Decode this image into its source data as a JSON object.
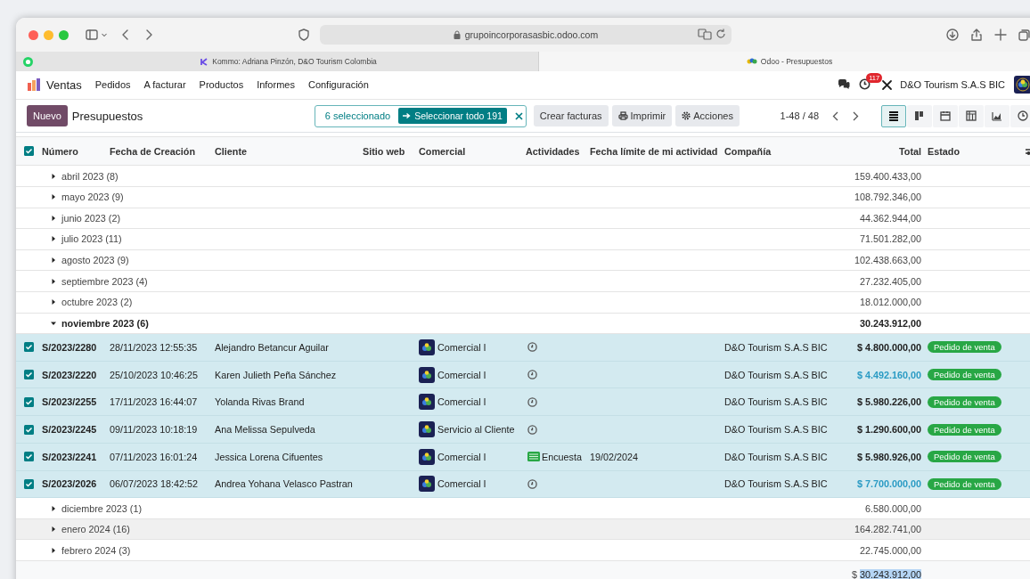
{
  "browser": {
    "url": "grupoincorporasasbic.odoo.com",
    "tabs": [
      {
        "title": "Kommo: Adriana Pinzón, D&O Tourism Colombia",
        "selected": false
      },
      {
        "title": "Odoo - Presupuestos",
        "selected": true
      }
    ]
  },
  "navbar": {
    "app": "Ventas",
    "menu": [
      "Pedidos",
      "A facturar",
      "Productos",
      "Informes",
      "Configuración"
    ],
    "activity_count": "117",
    "company": "D&O Tourism S.A.S BIC"
  },
  "control_panel": {
    "new_button": "Nuevo",
    "breadcrumb": "Presupuestos",
    "selected_count": "6 seleccionado",
    "select_all": "Seleccionar todo 191",
    "actions": [
      {
        "kind": "plain",
        "label": "Crear facturas"
      },
      {
        "kind": "print",
        "label": "Imprimir"
      },
      {
        "kind": "gear",
        "label": "Acciones"
      }
    ],
    "pager": "1-48 / 48",
    "views": [
      {
        "kind": "list",
        "selected": true
      },
      {
        "kind": "kanban",
        "selected": false
      },
      {
        "kind": "calendar",
        "selected": false
      },
      {
        "kind": "pivot",
        "selected": false
      },
      {
        "kind": "graph",
        "selected": false
      },
      {
        "kind": "activity",
        "selected": false
      }
    ]
  },
  "table": {
    "all_checked": true,
    "columns": [
      "Número",
      "Fecha de Creación",
      "Cliente",
      "Sitio web",
      "Comercial",
      "Actividades",
      "Fecha límite de mi actividad",
      "Compañía",
      "Total",
      "Estado"
    ],
    "rows": [
      {
        "kind": "group",
        "label": "abril 2023 (8)",
        "expanded": false,
        "hovered": false,
        "total": "159.400.433,00"
      },
      {
        "kind": "group",
        "label": "mayo 2023 (9)",
        "expanded": false,
        "hovered": false,
        "total": "108.792.346,00"
      },
      {
        "kind": "group",
        "label": "junio 2023 (2)",
        "expanded": false,
        "hovered": false,
        "total": "44.362.944,00"
      },
      {
        "kind": "group",
        "label": "julio 2023 (11)",
        "expanded": false,
        "hovered": false,
        "total": "71.501.282,00"
      },
      {
        "kind": "group",
        "label": "agosto 2023 (9)",
        "expanded": false,
        "hovered": false,
        "total": "102.438.663,00"
      },
      {
        "kind": "group",
        "label": "septiembre 2023 (4)",
        "expanded": false,
        "hovered": false,
        "total": "27.232.405,00"
      },
      {
        "kind": "group",
        "label": "octubre 2023 (2)",
        "expanded": false,
        "hovered": false,
        "total": "18.012.000,00"
      },
      {
        "kind": "group",
        "label": "noviembre 2023 (6)",
        "expanded": true,
        "hovered": false,
        "total": "30.243.912,00"
      },
      {
        "kind": "record",
        "checked": true,
        "number": "S/2023/2280",
        "date": "28/11/2023 12:55:35",
        "customer": "Alejandro Betancur Aguilar",
        "salesperson": "Comercial I",
        "activity": {
          "kind": "clock"
        },
        "company": "D&O Tourism S.A.S BIC",
        "total": "$ 4.800.000,00",
        "total_highlighted": false,
        "status": "Pedido de venta"
      },
      {
        "kind": "record",
        "checked": true,
        "number": "S/2023/2220",
        "date": "25/10/2023 10:46:25",
        "customer": "Karen Julieth Peña Sánchez",
        "salesperson": "Comercial I",
        "activity": {
          "kind": "clock"
        },
        "company": "D&O Tourism S.A.S BIC",
        "total": "$ 4.492.160,00",
        "total_highlighted": true,
        "status": "Pedido de venta"
      },
      {
        "kind": "record",
        "checked": true,
        "number": "S/2023/2255",
        "date": "17/11/2023 16:44:07",
        "customer": "Yolanda Rivas Brand",
        "salesperson": "Comercial I",
        "activity": {
          "kind": "clock"
        },
        "company": "D&O Tourism S.A.S BIC",
        "total": "$ 5.980.226,00",
        "total_highlighted": false,
        "status": "Pedido de venta"
      },
      {
        "kind": "record",
        "checked": true,
        "number": "S/2023/2245",
        "date": "09/11/2023 10:18:19",
        "customer": "Ana Melissa Sepulveda",
        "salesperson": "Servicio al Cliente",
        "activity": {
          "kind": "clock"
        },
        "company": "D&O Tourism S.A.S BIC",
        "total": "$ 1.290.600,00",
        "total_highlighted": false,
        "status": "Pedido de venta"
      },
      {
        "kind": "record",
        "checked": true,
        "number": "S/2023/2241",
        "date": "07/11/2023 16:01:24",
        "customer": "Jessica Lorena Cifuentes",
        "salesperson": "Comercial I",
        "activity": {
          "kind": "survey",
          "label": "Encuesta"
        },
        "deadline": "19/02/2024",
        "company": "D&O Tourism S.A.S BIC",
        "total": "$ 5.980.926,00",
        "total_highlighted": false,
        "status": "Pedido de venta"
      },
      {
        "kind": "record",
        "checked": true,
        "number": "S/2023/2026",
        "date": "06/07/2023 18:42:52",
        "customer": "Andrea Yohana Velasco Pastran",
        "salesperson": "Comercial I",
        "activity": {
          "kind": "clock"
        },
        "company": "D&O Tourism S.A.S BIC",
        "total": "$ 7.700.000,00",
        "total_highlighted": true,
        "status": "Pedido de venta"
      },
      {
        "kind": "group",
        "label": "diciembre 2023 (1)",
        "expanded": false,
        "hovered": false,
        "total": "6.580.000,00"
      },
      {
        "kind": "group",
        "label": "enero 2024 (16)",
        "expanded": false,
        "hovered": true,
        "total": "164.282.741,00"
      },
      {
        "kind": "group",
        "label": "febrero 2024 (3)",
        "expanded": false,
        "hovered": false,
        "total": "22.745.000,00"
      }
    ],
    "footer": {
      "currency": "$",
      "amount": "30.243.912,00",
      "highlighted": true
    }
  }
}
